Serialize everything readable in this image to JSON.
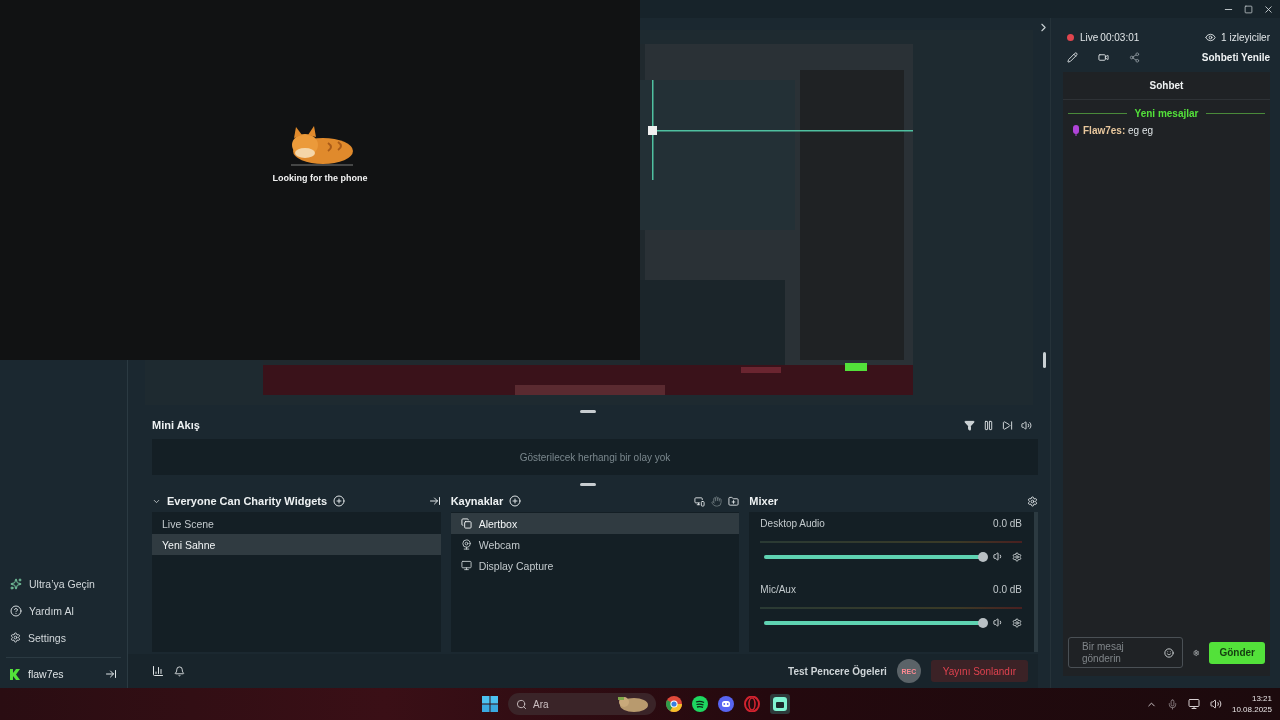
{
  "overlay_window": {
    "caption": "Looking for the phone"
  },
  "sidebar": {
    "items": [
      {
        "label": "Ultra’ya Geçin",
        "kind": "ultra"
      },
      {
        "label": "Yardım Al",
        "kind": "help"
      },
      {
        "label": "Settings",
        "kind": "settings"
      }
    ],
    "user": "flaw7es"
  },
  "mini_feed": {
    "title": "Mini Akış",
    "empty_text": "Gösterilecek herhangi bir olay yok"
  },
  "scenes": {
    "title": "Everyone Can Charity Widgets",
    "items": [
      {
        "label": "Live Scene",
        "selected": false
      },
      {
        "label": "Yeni Sahne",
        "selected": true
      }
    ]
  },
  "sources": {
    "title": "Kaynaklar",
    "items": [
      {
        "label": "Alertbox",
        "kind": "alertbox",
        "selected": true
      },
      {
        "label": "Webcam",
        "kind": "webcam",
        "selected": false
      },
      {
        "label": "Display Capture",
        "kind": "display",
        "selected": false
      }
    ]
  },
  "mixer": {
    "title": "Mixer",
    "channels": [
      {
        "name": "Desktop Audio",
        "reading": "0.0 dB",
        "level": 0.99
      },
      {
        "name": "Mic/Aux",
        "reading": "0.0 dB",
        "level": 0.99
      }
    ]
  },
  "footer": {
    "test_label": "Test Pencere Ögeleri",
    "rec": "REC",
    "end_stream": "Yayını Sonlandır"
  },
  "chat": {
    "live_label": "Live",
    "timer": "00:03:01",
    "viewers": "1 izleyiciler",
    "refresh": "Sohbeti Yenile",
    "title": "Sohbet",
    "new_messages": "Yeni mesajlar",
    "messages": [
      {
        "author": "Flaw7es:",
        "text": "eg eg"
      }
    ],
    "input_placeholder": "Bir mesaj gönderin",
    "send": "Gönder"
  },
  "taskbar": {
    "search_placeholder": "Ara",
    "clock": "13:21",
    "date": "10.08.2025"
  }
}
